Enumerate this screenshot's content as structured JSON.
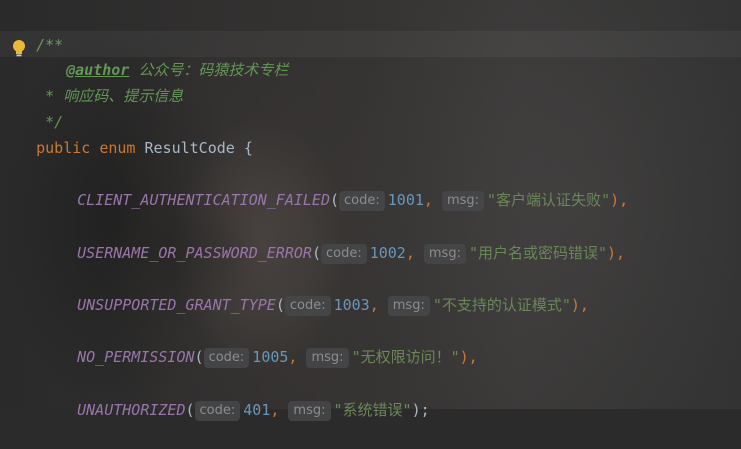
{
  "comment": {
    "open": "/**",
    "author_tag": "@author",
    "author_text": " 公众号：码猿技术专栏",
    "desc_line": " * 响应码、提示信息",
    "close": " */"
  },
  "declaration": {
    "modifier": "public",
    "kind": "enum",
    "name": "ResultCode",
    "brace": "{"
  },
  "hints": {
    "code": "code:",
    "msg": "msg:"
  },
  "constants": [
    {
      "name": "CLIENT_AUTHENTICATION_FAILED",
      "code": "1001",
      "msg": "\"客户端认证失败\"",
      "end": "),"
    },
    {
      "name": "USERNAME_OR_PASSWORD_ERROR",
      "code": "1002",
      "msg": "\"用户名或密码错误\"",
      "end": "),"
    },
    {
      "name": "UNSUPPORTED_GRANT_TYPE",
      "code": "1003",
      "msg": "\"不支持的认证模式\"",
      "end": "),"
    },
    {
      "name": "NO_PERMISSION",
      "code": "1005",
      "msg": "\"无权限访问！\"",
      "end": "),"
    },
    {
      "name": "UNAUTHORIZED",
      "code": "401",
      "msg": "\"系统错误\"",
      "end": ");"
    }
  ],
  "colors": {
    "comment": "#629755",
    "keyword": "#cc7832",
    "constant": "#9876aa",
    "number": "#6897bb",
    "string": "#6a8759",
    "bulb": "#e8b730"
  },
  "icons": {
    "gutter": "lightbulb-icon"
  }
}
